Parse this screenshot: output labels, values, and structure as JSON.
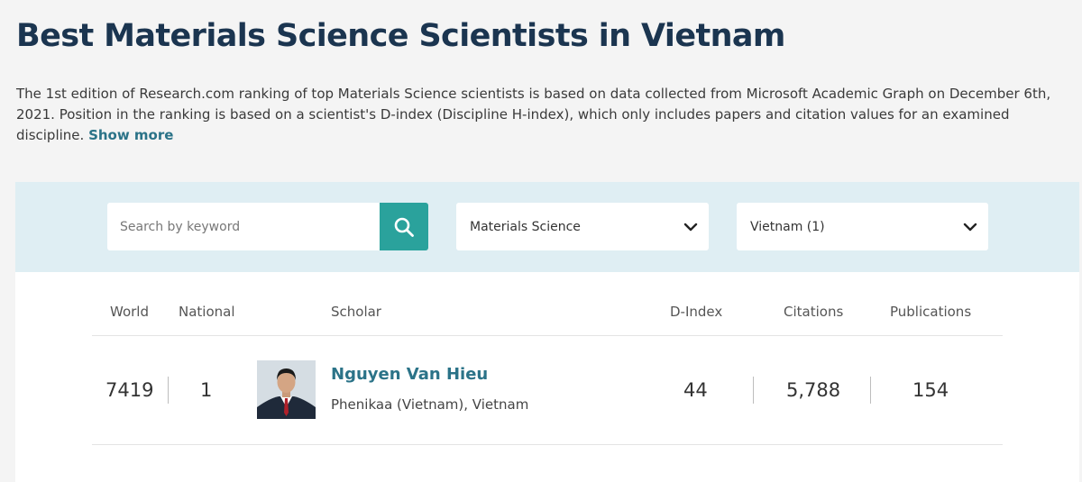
{
  "header": {
    "title": "Best Materials Science Scientists in Vietnam",
    "intro": "The 1st edition of Research.com ranking of top Materials Science scientists is based on data collected from Microsoft Academic Graph on December 6th, 2021. Position in the ranking is based on a scientist's D-index (Discipline H-index), which only includes papers and citation values for an examined discipline.",
    "show_more": "Show more"
  },
  "filters": {
    "search_placeholder": "Search by keyword",
    "search_icon": "search-icon",
    "discipline": "Materials Science",
    "country": "Vietnam (1)",
    "dropdown_icon": "chevron-down-icon"
  },
  "table": {
    "columns": [
      "World",
      "National",
      "Scholar",
      "D-Index",
      "Citations",
      "Publications"
    ],
    "rows": [
      {
        "world": "7419",
        "national": "1",
        "name": "Nguyen Van Hieu",
        "affiliation": "Phenikaa (Vietnam), Vietnam",
        "d_index": "44",
        "citations": "5,788",
        "publications": "154"
      }
    ]
  },
  "colors": {
    "title": "#1b3550",
    "accent_link": "#2b7388",
    "search_button": "#2aa29c",
    "filter_bar": "#dfeef3"
  }
}
